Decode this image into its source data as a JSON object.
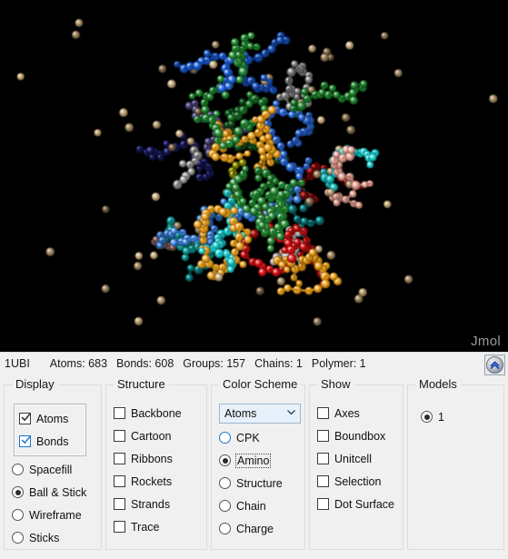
{
  "viewport": {
    "name": "jmol-3d-viewport",
    "background_color": "#000000",
    "watermark": "Jmol",
    "watermark_color": "#9a9a9a",
    "rendering_style": "Ball & Stick",
    "color_scheme": "Amino",
    "palette": {
      "green": "#1e8a2e",
      "blue": "#1a5fe0",
      "royal_blue": "#2b6fe8",
      "light_blue": "#3a86e8",
      "cyan": "#16d4d4",
      "orange": "#f0a014",
      "red": "#e01010",
      "tan": "#c8a878",
      "white": "#e8e8e8",
      "salmon": "#e8a090",
      "purple": "#8a7ad0",
      "indigo": "#2a2a9a",
      "yellow": "#e8e810",
      "grey": "#b0b0b0"
    }
  },
  "statusbar": {
    "pdb_id": "1UBI",
    "atoms_label": "Atoms: 683",
    "bonds_label": "Bonds: 608",
    "groups_label": "Groups: 157",
    "chains_label": "Chains: 1",
    "polymer_label": "Polymer: 1",
    "collapse_button_icon": "double-chevron-up-icon"
  },
  "panels": {
    "display": {
      "title": "Display",
      "checkboxes": [
        {
          "label": "Atoms",
          "checked": true,
          "accent": false
        },
        {
          "label": "Bonds",
          "checked": true,
          "accent": true
        }
      ],
      "radios": [
        {
          "label": "Spacefill",
          "selected": false
        },
        {
          "label": "Ball & Stick",
          "selected": true
        },
        {
          "label": "Wireframe",
          "selected": false
        },
        {
          "label": "Sticks",
          "selected": false
        }
      ]
    },
    "structure": {
      "title": "Structure",
      "checkboxes": [
        {
          "label": "Backbone",
          "checked": false
        },
        {
          "label": "Cartoon",
          "checked": false
        },
        {
          "label": "Ribbons",
          "checked": false
        },
        {
          "label": "Rockets",
          "checked": false
        },
        {
          "label": "Strands",
          "checked": false
        },
        {
          "label": "Trace",
          "checked": false
        }
      ]
    },
    "color_scheme": {
      "title": "Color Scheme",
      "dropdown": {
        "value": "Atoms",
        "icon": "chevron-down-icon"
      },
      "radios": [
        {
          "label": "CPK",
          "selected": false,
          "accent": true,
          "focused": false
        },
        {
          "label": "Amino",
          "selected": true,
          "accent": false,
          "focused": true
        },
        {
          "label": "Structure",
          "selected": false,
          "accent": false,
          "focused": false
        },
        {
          "label": "Chain",
          "selected": false,
          "accent": false,
          "focused": false
        },
        {
          "label": "Charge",
          "selected": false,
          "accent": false,
          "focused": false
        }
      ]
    },
    "show": {
      "title": "Show",
      "checkboxes": [
        {
          "label": "Axes",
          "checked": false
        },
        {
          "label": "Boundbox",
          "checked": false
        },
        {
          "label": "Unitcell",
          "checked": false
        },
        {
          "label": "Selection",
          "checked": false
        },
        {
          "label": "Dot Surface",
          "checked": false
        }
      ]
    },
    "models": {
      "title": "Models",
      "radios": [
        {
          "label": "1",
          "selected": true
        }
      ]
    }
  }
}
